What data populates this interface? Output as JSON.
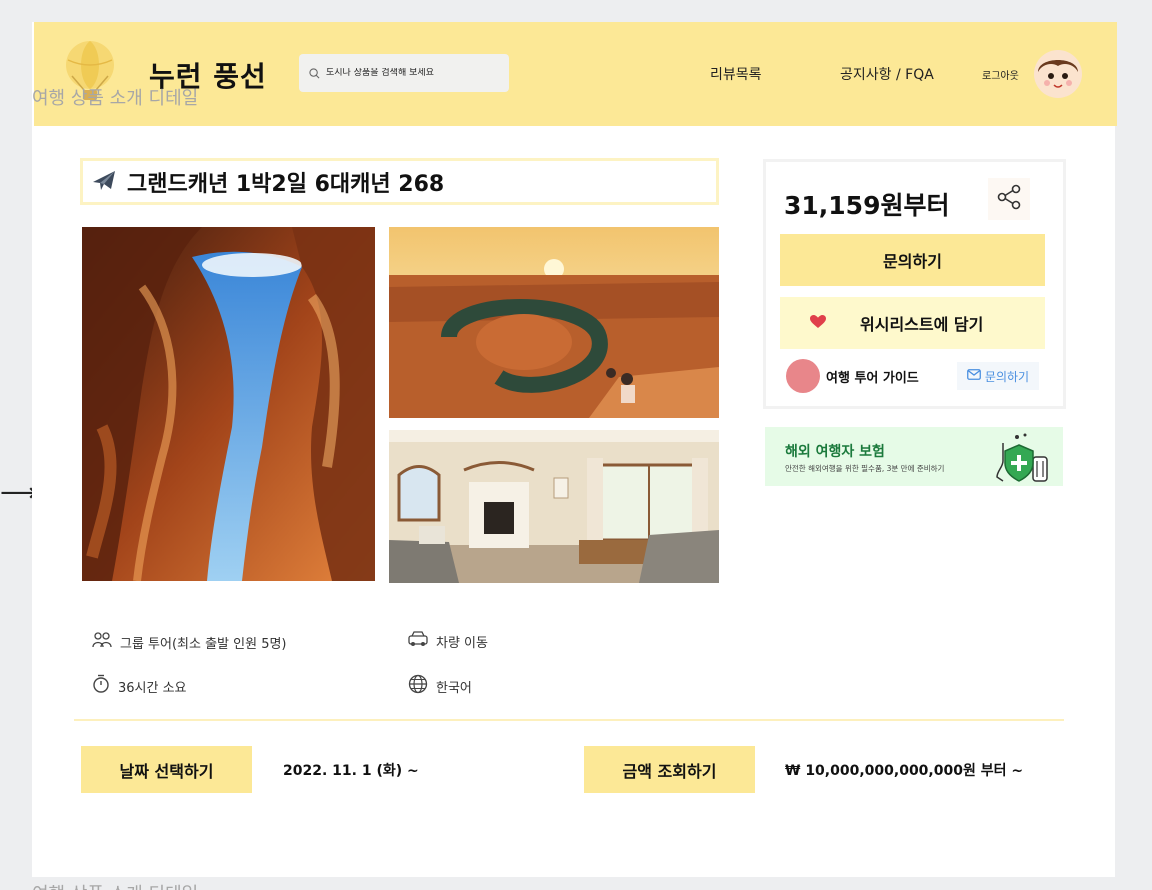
{
  "canvas": {
    "label": "여행 상품 소개 디테일",
    "label_bottom": "여행 상품 소개 디테일"
  },
  "header": {
    "brand": "누런 풍선",
    "search_placeholder": "도시나 상품을 검색해 보세요",
    "nav": {
      "reviews": "리뷰목록",
      "notice": "공지사항 / FQA",
      "logout": "로그아웃"
    }
  },
  "product": {
    "title": "그랜드캐년 1박2일 6대캐년 268",
    "title_icon": "airplane-icon",
    "info": [
      {
        "icon": "group-icon",
        "text": "그룹 투어(최소 출발 인원 5명)"
      },
      {
        "icon": "car-icon",
        "text": "차량 이동"
      },
      {
        "icon": "timer-icon",
        "text": "36시간 소요"
      },
      {
        "icon": "globe-icon",
        "text": "한국어"
      }
    ],
    "date_button": "날짜 선택하기",
    "date_value": "2022. 11. 1 (화) ~",
    "price_button": "금액 조회하기",
    "price_value": "₩ 10,000,000,000,000원 부터 ~"
  },
  "card": {
    "price": "31,159원부터",
    "inquiry_button": "문의하기",
    "wishlist_button": "위시리스트에 담기",
    "guide_name": "여행 투어 가이드",
    "guide_inquiry": "문의하기"
  },
  "insurance": {
    "title": "해외 여행자 보험",
    "subtitle": "안전한 해외여행을 위한 필수품, 3분 만에 준비하기"
  },
  "colors": {
    "accent_yellow": "#fce896",
    "wish_bg": "#fef9cc",
    "heart": "#e0404a",
    "insurance_bg": "#e6fbe7",
    "insurance_text": "#1b7a3c",
    "link_blue": "#4a8fe0"
  }
}
